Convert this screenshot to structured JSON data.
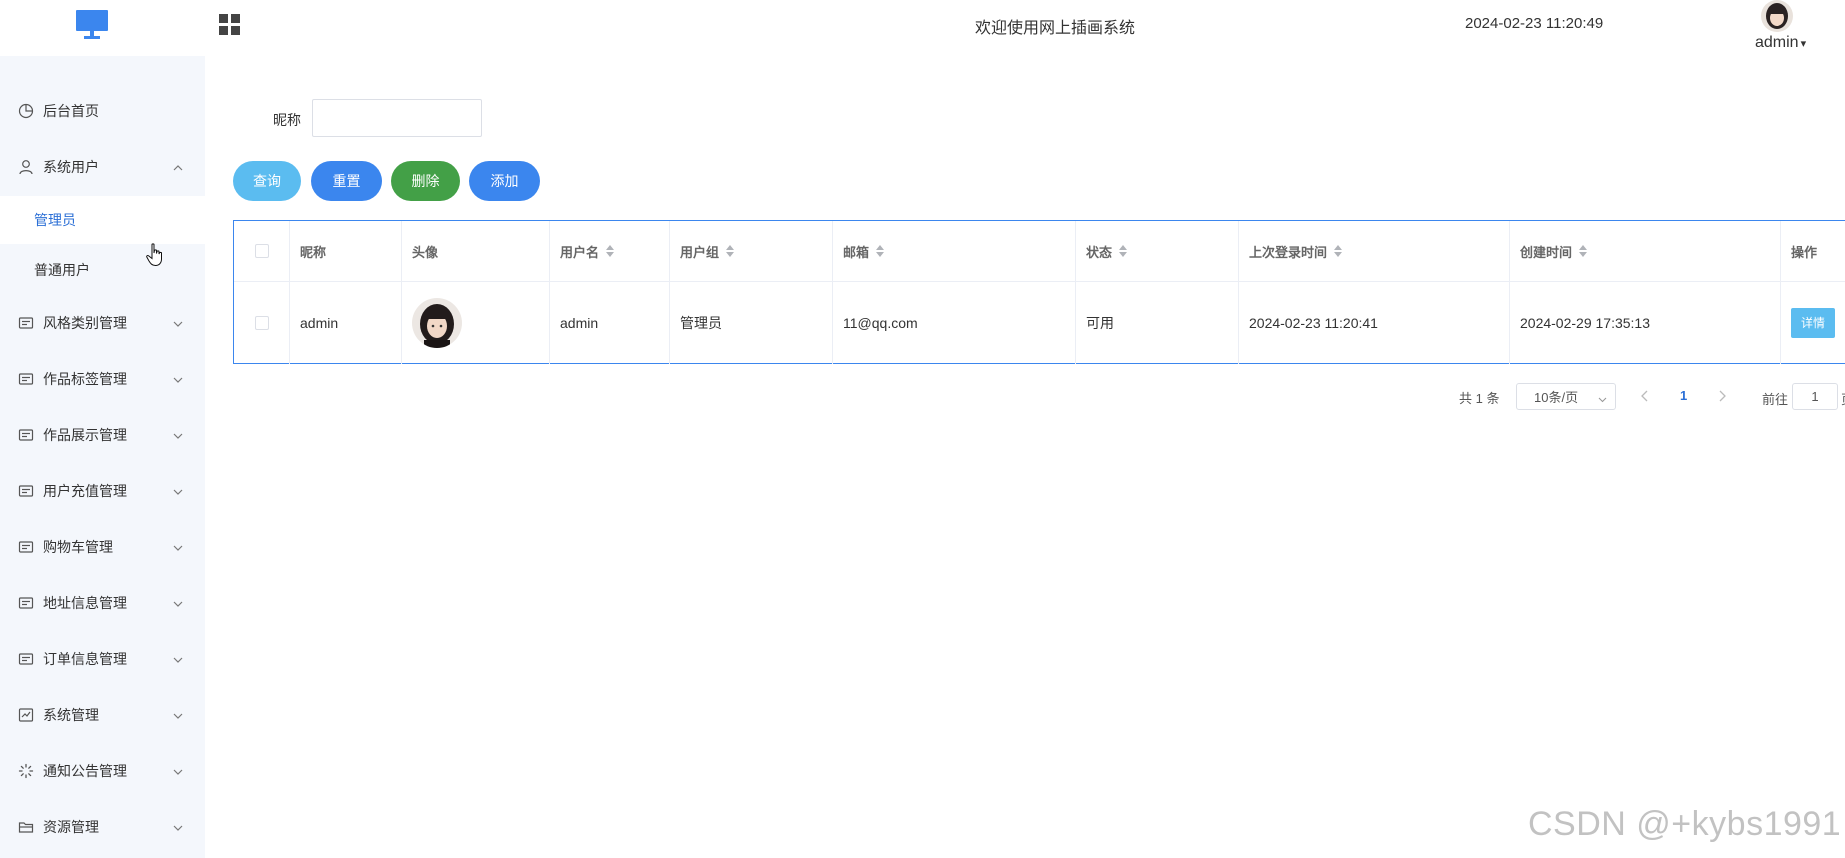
{
  "header": {
    "title": "欢迎使用网上插画系统",
    "datetime": "2024-02-23 11:20:49",
    "username": "admin",
    "logo_icon": "monitor-icon",
    "menu_toggle_icon": "grid-icon"
  },
  "sidebar": {
    "items": [
      {
        "label": "后台首页",
        "icon": "pie-chart-icon"
      },
      {
        "label": "系统用户",
        "icon": "user-icon",
        "expanded": true
      },
      {
        "label": "风格类别管理",
        "icon": "list-icon"
      },
      {
        "label": "作品标签管理",
        "icon": "list-icon"
      },
      {
        "label": "作品展示管理",
        "icon": "list-icon"
      },
      {
        "label": "用户充值管理",
        "icon": "list-icon"
      },
      {
        "label": "购物车管理",
        "icon": "list-icon"
      },
      {
        "label": "地址信息管理",
        "icon": "list-icon"
      },
      {
        "label": "订单信息管理",
        "icon": "list-icon"
      },
      {
        "label": "系统管理",
        "icon": "chart-box-icon"
      },
      {
        "label": "通知公告管理",
        "icon": "loading-icon"
      },
      {
        "label": "资源管理",
        "icon": "folder-icon"
      }
    ],
    "sub_items": [
      {
        "label": "管理员",
        "active": true
      },
      {
        "label": "普通用户",
        "active": false
      }
    ]
  },
  "search": {
    "label": "昵称",
    "value": ""
  },
  "buttons": {
    "query": "查询",
    "reset": "重置",
    "delete": "删除",
    "add": "添加"
  },
  "table": {
    "columns": [
      "昵称",
      "头像",
      "用户名",
      "用户组",
      "邮箱",
      "状态",
      "上次登录时间",
      "创建时间",
      "操作"
    ],
    "rows": [
      {
        "nickname": "admin",
        "username": "admin",
        "group": "管理员",
        "email": "11@qq.com",
        "status": "可用",
        "last_login": "2024-02-23 11:20:41",
        "created": "2024-02-29 17:35:13",
        "action": "详情"
      }
    ]
  },
  "pagination": {
    "total": "共 1 条",
    "page_size": "10条/页",
    "current_page": "1",
    "goto_label": "前往",
    "goto_value": "1",
    "goto_suffix": "页"
  },
  "watermark": "CSDN @+kybs1991",
  "colors": {
    "primary": "#3b86ee",
    "info": "#5bbcf0",
    "success": "#43a047",
    "sidebar_bg": "#f4f7fc",
    "active_text": "#2b6fd6"
  }
}
